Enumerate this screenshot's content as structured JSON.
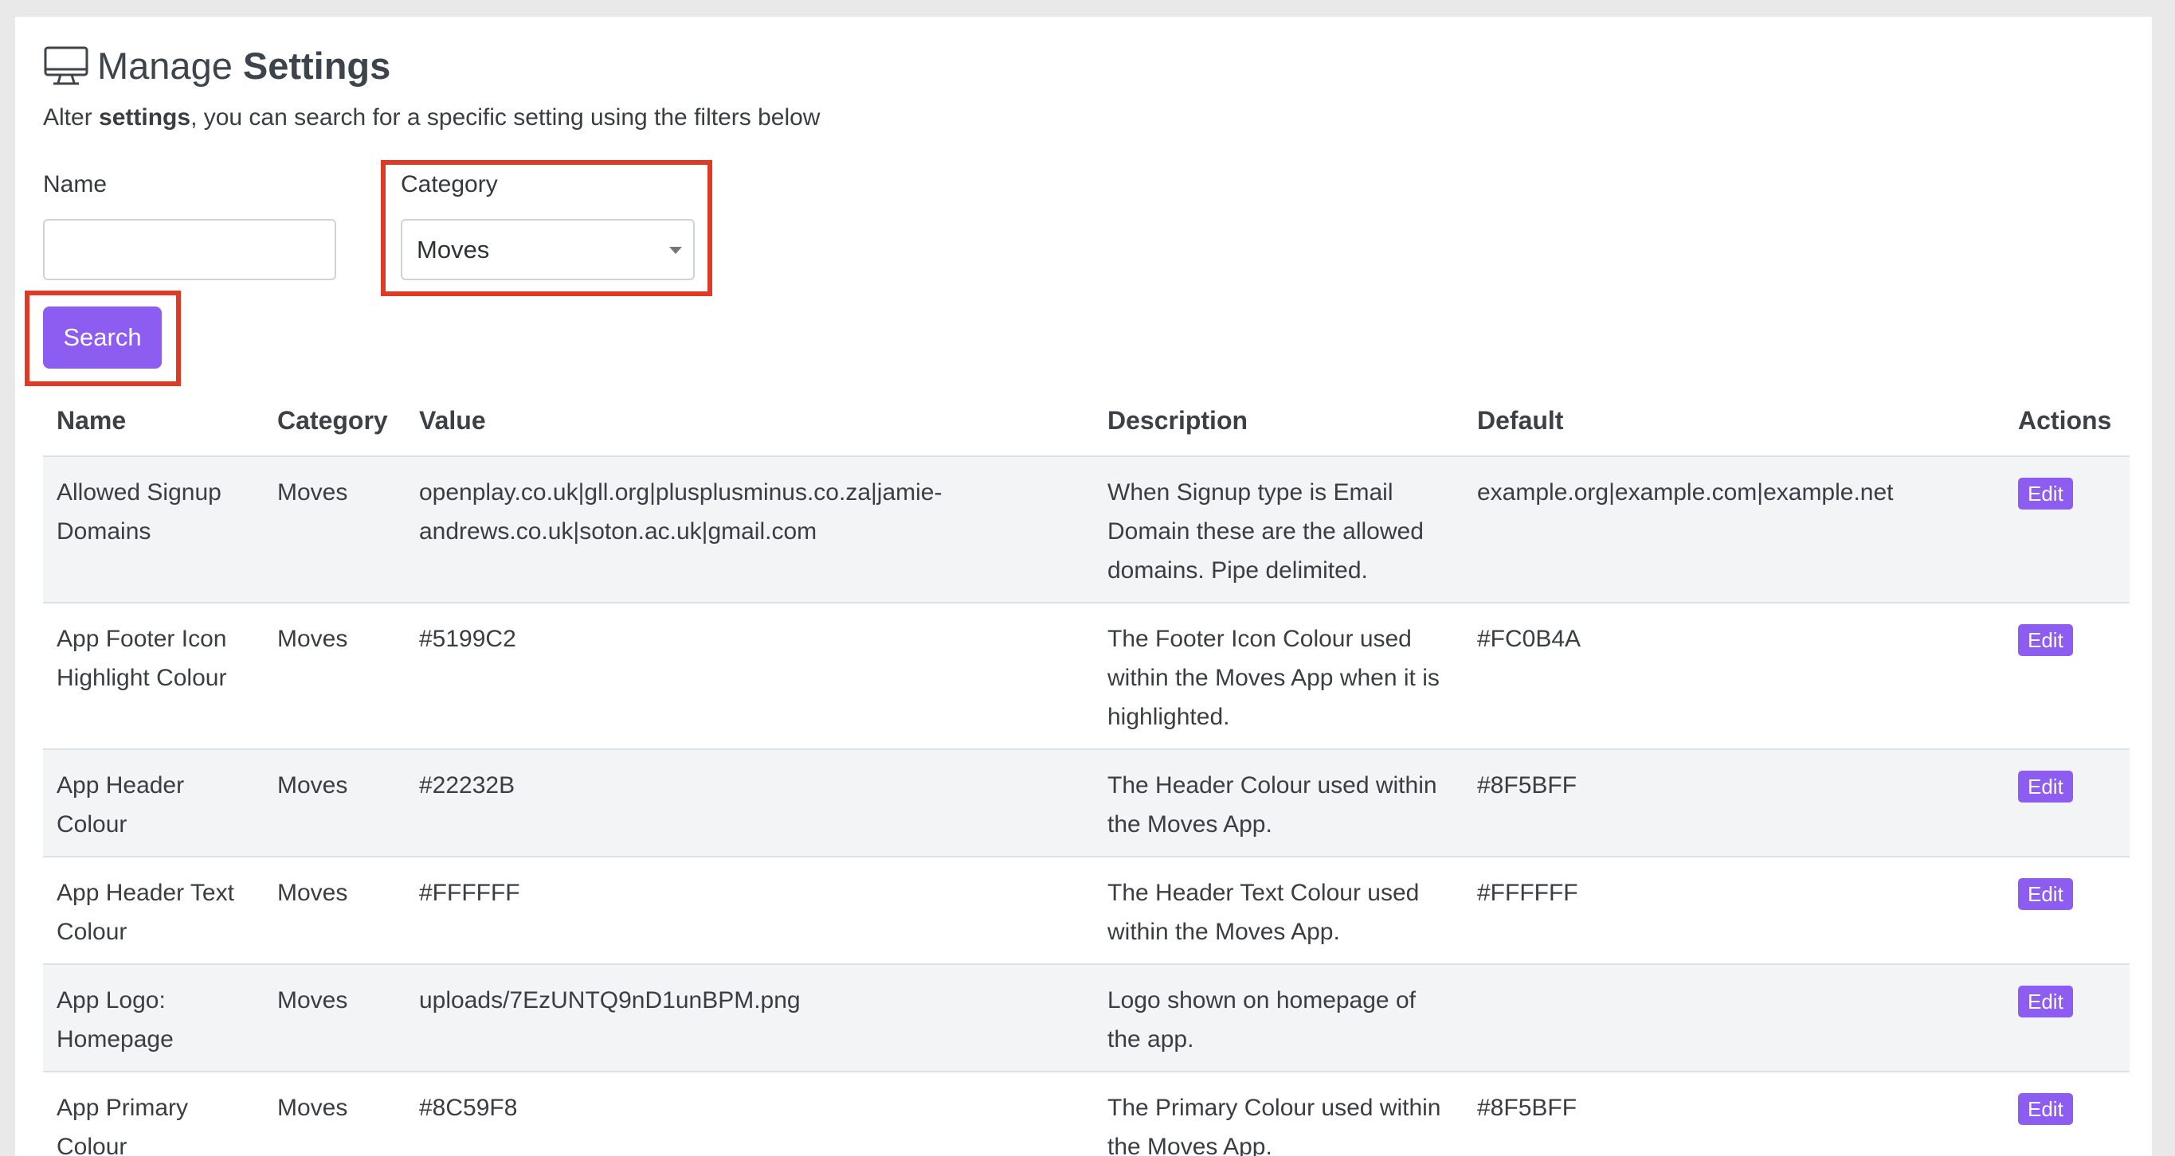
{
  "header": {
    "title_prefix": "Manage",
    "title_strong": "Settings",
    "icon": "monitor-icon",
    "subtitle_pre": "Alter ",
    "subtitle_strong": "settings",
    "subtitle_post": ", you can search for a specific setting using the filters below"
  },
  "filters": {
    "name_label": "Name",
    "name_value": "",
    "category_label": "Category",
    "category_value": "Moves",
    "search_label": "Search"
  },
  "colors": {
    "accent": "#8d5cf0",
    "highlight": "#e03a25"
  },
  "table": {
    "headers": [
      "Name",
      "Category",
      "Value",
      "Description",
      "Default",
      "Actions"
    ],
    "rows": [
      {
        "name": "Allowed Signup Domains",
        "category": "Moves",
        "value": "openplay.co.uk|gll.org|plusplusminus.co.za|jamie-andrews.co.uk|soton.ac.uk|gmail.com",
        "description": "When Signup type is Email Domain these are the allowed domains. Pipe delimited.",
        "default": "example.org|example.com|example.net",
        "action": "Edit"
      },
      {
        "name": "App Footer Icon Highlight Colour",
        "category": "Moves",
        "value": "#5199C2",
        "description": "The Footer Icon Colour used within the Moves App when it is highlighted.",
        "default": "#FC0B4A",
        "action": "Edit"
      },
      {
        "name": "App Header Colour",
        "category": "Moves",
        "value": "#22232B",
        "description": "The Header Colour used within the Moves App.",
        "default": "#8F5BFF",
        "action": "Edit"
      },
      {
        "name": "App Header Text Colour",
        "category": "Moves",
        "value": "#FFFFFF",
        "description": "The Header Text Colour used within the Moves App.",
        "default": "#FFFFFF",
        "action": "Edit"
      },
      {
        "name": "App Logo: Homepage",
        "category": "Moves",
        "value": "uploads/7EzUNTQ9nD1unBPM.png",
        "description": "Logo shown on homepage of the app.",
        "default": "",
        "action": "Edit"
      },
      {
        "name": "App Primary Colour",
        "category": "Moves",
        "value": "#8C59F8",
        "description": "The Primary Colour used within the Moves App.",
        "default": "#8F5BFF",
        "action": "Edit"
      }
    ]
  }
}
